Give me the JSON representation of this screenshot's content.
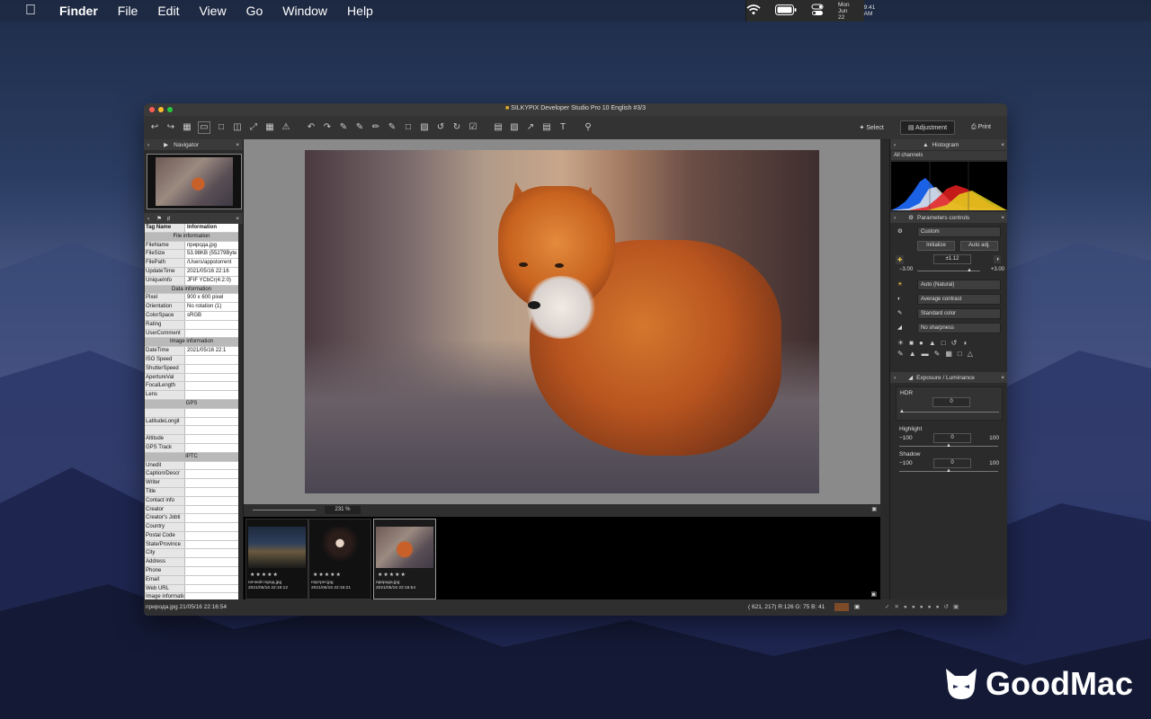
{
  "menubar": {
    "app": "Finder",
    "items": [
      "File",
      "Edit",
      "View",
      "Go",
      "Window",
      "Help"
    ],
    "date": "Mon Jun 22",
    "time": "9:41 AM"
  },
  "window": {
    "title": "SILKYPIX Developer Studio Pro 10 English   #3/3"
  },
  "toolbar": {
    "select": "Select",
    "adjustment": "Adjustment",
    "print": "Print"
  },
  "left": {
    "navigator_title": "Navigator",
    "info_header": {
      "k": "Tag Name",
      "v": "Information"
    },
    "rows": [
      {
        "sec": "File information"
      },
      {
        "k": "FileName",
        "v": "природа.jpg"
      },
      {
        "k": "FileSize",
        "v": "53.98KB (55279Byte"
      },
      {
        "k": "FilePath",
        "v": "/Users/appstorrent"
      },
      {
        "k": "UpdateTime",
        "v": "2021/05/16 22:16"
      },
      {
        "k": "UniqueInfo",
        "v": "JFIF YCbCr(4:2:0)"
      },
      {
        "sec": "Data information"
      },
      {
        "k": "Pixel",
        "v": "900 x 600 pixel"
      },
      {
        "k": "Orientation",
        "v": "No rotation (1)"
      },
      {
        "k": "ColorSpace",
        "v": "sRGB"
      },
      {
        "k": "Rating",
        "v": ""
      },
      {
        "k": "UserComment",
        "v": ""
      },
      {
        "sec": "Image information"
      },
      {
        "k": "DateTime",
        "v": "2021/05/16 22:1"
      },
      {
        "k": "ISO Speed",
        "v": ""
      },
      {
        "k": "ShutterSpeed",
        "v": ""
      },
      {
        "k": "ApertureVal",
        "v": ""
      },
      {
        "k": "FocalLength",
        "v": ""
      },
      {
        "k": "Lens",
        "v": ""
      },
      {
        "sec": "GPS"
      },
      {
        "k": "",
        "v": ""
      },
      {
        "k": "LatitudeLongit",
        "v": ""
      },
      {
        "k": "",
        "v": ""
      },
      {
        "k": "Altitude",
        "v": ""
      },
      {
        "k": "GPS Track",
        "v": ""
      },
      {
        "sec": "IPTC"
      },
      {
        "k": "Unedit",
        "v": ""
      },
      {
        "k": "Caption/Descr",
        "v": ""
      },
      {
        "k": "Writer",
        "v": ""
      },
      {
        "k": "Title",
        "v": ""
      },
      {
        "k": "Contact info",
        "v": ""
      },
      {
        "k": "Creator",
        "v": ""
      },
      {
        "k": "Creator's Jobti",
        "v": ""
      },
      {
        "k": "Country",
        "v": ""
      },
      {
        "k": "Postal Code",
        "v": ""
      },
      {
        "k": "State/Province",
        "v": ""
      },
      {
        "k": "City",
        "v": ""
      },
      {
        "k": "Address",
        "v": ""
      },
      {
        "k": "Phone",
        "v": ""
      },
      {
        "k": "Email",
        "v": ""
      },
      {
        "k": "Web URL",
        "v": ""
      },
      {
        "k": "Image information",
        "v": ""
      },
      {
        "k": "Date Created",
        "v": ""
      },
      {
        "k": "Country",
        "v": ""
      },
      {
        "k": "ISO Country C",
        "v": ""
      },
      {
        "k": "Province/State",
        "v": ""
      }
    ]
  },
  "center": {
    "zoom": "231 %"
  },
  "film": [
    {
      "name": "ночной город.jpg",
      "date": "2021/05/16 22:16:12"
    },
    {
      "name": "портрет.jpg",
      "date": "2021/05/16 22:16:21"
    },
    {
      "name": "природа.jpg",
      "date": "2021/05/16 22:16:54"
    }
  ],
  "film_stars": "★★★★★",
  "right": {
    "histogram_title": "Histogram",
    "channels": "All channels",
    "params_title": "Parameters controls",
    "preset": "Custom",
    "initialize": "Initialize",
    "auto_adj": "Auto adj.",
    "exposure_value": "±1.12",
    "min_ev": "−3.00",
    "max_ev": "+3.00",
    "wb": "Auto (Natural)",
    "contrast": "Average contrast",
    "color": "Standard color",
    "sharpness": "No sharpness",
    "exposure_title": "Exposure / Luminance",
    "hdr": "HDR",
    "hdr_value": "0",
    "highlight": "Highlight",
    "highlight_min": "−100",
    "highlight_value": "0",
    "highlight_max": "100",
    "shadow": "Shadow",
    "shadow_min": "−100",
    "shadow_value": "0",
    "shadow_max": "100"
  },
  "bottom": {
    "file": "природа.jpg 21/05/16 22:16:54",
    "coords": "( 621, 217) R:126 G: 75 B: 41"
  },
  "watermark": "GoodMac",
  "colors": {
    "accent": "#c7621f",
    "window_bg": "#2a2a2a",
    "swatch": "#7e4b29"
  }
}
